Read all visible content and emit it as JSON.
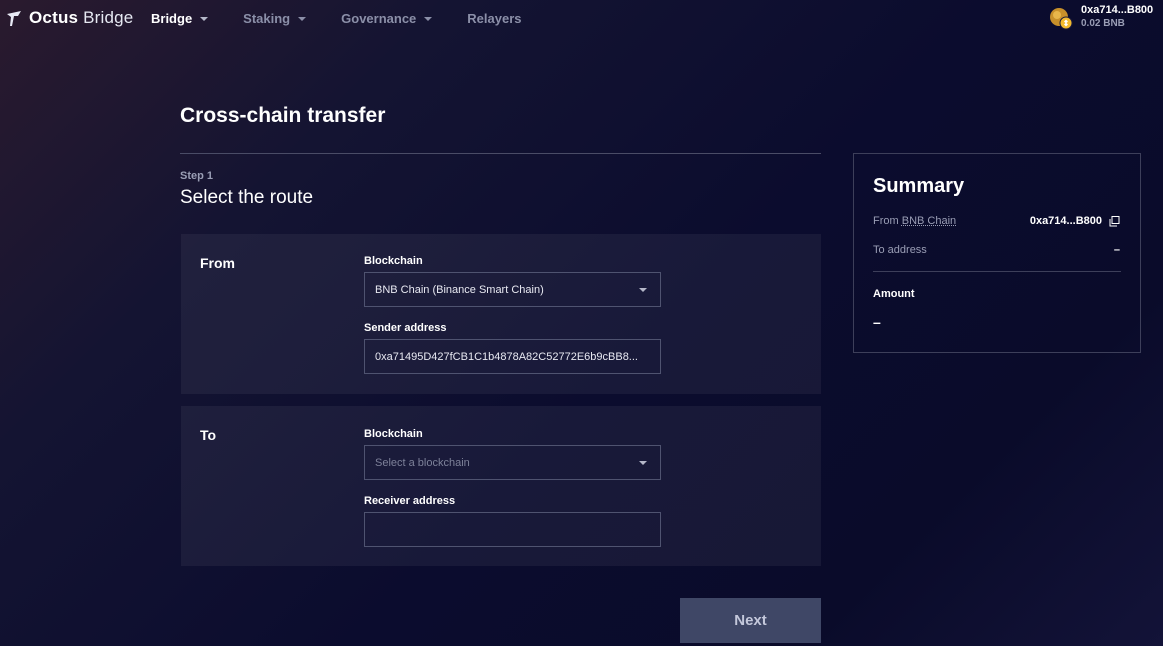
{
  "header": {
    "logo_bold": "Octus",
    "logo_light": "Bridge",
    "nav": [
      {
        "label": "Bridge",
        "dropdown": true
      },
      {
        "label": "Staking",
        "dropdown": true
      },
      {
        "label": "Governance",
        "dropdown": true
      },
      {
        "label": "Relayers",
        "dropdown": false
      }
    ],
    "wallet": {
      "address": "0xa714...B800",
      "balance": "0.02 BNB"
    }
  },
  "main": {
    "title": "Cross-chain transfer",
    "step_label": "Step 1",
    "step_title": "Select the route",
    "from": {
      "title": "From",
      "blockchain_label": "Blockchain",
      "blockchain_value": "BNB Chain (Binance Smart Chain)",
      "address_label": "Sender address",
      "address_value": "0xa71495D427fCB1C1b4878A82C52772E6b9cBB8..."
    },
    "to": {
      "title": "To",
      "blockchain_label": "Blockchain",
      "blockchain_placeholder": "Select a blockchain",
      "address_label": "Receiver address",
      "address_value": ""
    },
    "next_label": "Next"
  },
  "summary": {
    "title": "Summary",
    "from_prefix": "From",
    "from_chain": "BNB Chain",
    "from_value": "0xa714...B800",
    "to_label": "To address",
    "to_value": "–",
    "amount_label": "Amount",
    "amount_value": "–"
  },
  "colors": {
    "accent_button": "#3f4766",
    "panel_border": "#4f5370",
    "muted_text": "#9a9eb5"
  }
}
